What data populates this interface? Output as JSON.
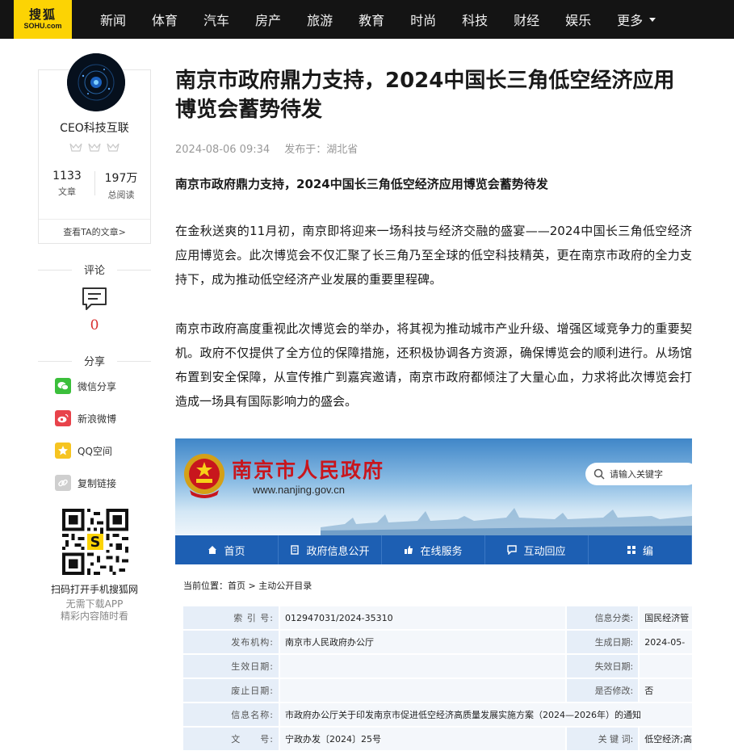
{
  "header": {
    "logo_cn": "搜狐",
    "logo_en": "SOHU.com",
    "nav": [
      "新闻",
      "体育",
      "汽车",
      "房产",
      "旅游",
      "教育",
      "时尚",
      "科技",
      "财经",
      "娱乐"
    ],
    "more_label": "更多"
  },
  "author": {
    "name": "CEO科技互联",
    "articles_count": "1133",
    "articles_label": "文章",
    "reads_count": "197万",
    "reads_label": "总阅读",
    "view_link": "查看TA的文章>"
  },
  "comments": {
    "title": "评论",
    "count": "0"
  },
  "share": {
    "title": "分享",
    "items": [
      {
        "label": "微信分享",
        "icon": "wechat-icon",
        "color": "#3bbf3b"
      },
      {
        "label": "新浪微博",
        "icon": "weibo-icon",
        "color": "#e8434b"
      },
      {
        "label": "QQ空间",
        "icon": "qzone-icon",
        "color": "#f6c421"
      },
      {
        "label": "复制链接",
        "icon": "link-icon",
        "color": "#cfcfcf"
      }
    ]
  },
  "qr": {
    "title": "扫码打开手机搜狐网",
    "sub1": "无需下载APP",
    "sub2": "精彩内容随时看"
  },
  "article": {
    "title": "南京市政府鼎力支持，2024中国长三角低空经济应用博览会蓄势待发",
    "date": "2024-08-06 09:34",
    "location": "发布于：湖北省",
    "lead": "南京市政府鼎力支持，2024中国长三角低空经济应用博览会蓄势待发",
    "paragraphs": [
      "在金秋送爽的11月初，南京即将迎来一场科技与经济交融的盛宴——2024中国长三角低空经济应用博览会。此次博览会不仅汇聚了长三角乃至全球的低空科技精英，更在南京市政府的全力支持下，成为推动低空经济产业发展的重要里程碑。",
      "南京市政府高度重视此次博览会的举办，将其视为推动城市产业升级、增强区域竞争力的重要契机。政府不仅提供了全方位的保障措施，还积极协调各方资源，确保博览会的顺利进行。从场馆布置到安全保障，从宣传推广到嘉宾邀请，南京市政府都倾注了大量心血，力求将此次博览会打造成一场具有国际影响力的盛会。"
    ]
  },
  "embedded": {
    "gov_name": "南京市人民政府",
    "gov_url": "www.nanjing.gov.cn",
    "search_placeholder": "请输入关键字",
    "nav": [
      "首页",
      "政府信息公开",
      "在线服务",
      "互动回应",
      "编"
    ],
    "crumb_label": "当前位置：",
    "crumb_path": "首页 > 主动公开目录",
    "rows": [
      {
        "l1": "索 引 号:",
        "v1": "012947031/2024-35310",
        "l2": "信息分类:",
        "v2": "国民经济管"
      },
      {
        "l1": "发布机构:",
        "v1": "南京市人民政府办公厅",
        "l2": "生成日期:",
        "v2": "2024-05-"
      },
      {
        "l1": "生效日期:",
        "v1": "",
        "l2": "失效日期:",
        "v2": ""
      },
      {
        "l1": "废止日期:",
        "v1": "",
        "l2": "是否修改:",
        "v2": "否"
      },
      {
        "l1": "信息名称:",
        "v1": "市政府办公厅关于印发南京市促进低空经济高质量发展实施方案（2024—2026年）的通知",
        "l2": "",
        "v2": ""
      },
      {
        "l1": "文　　号:",
        "v1": "宁政办发〔2024〕25号",
        "l2": "关 键 词:",
        "v2": "低空经济;高"
      }
    ]
  }
}
